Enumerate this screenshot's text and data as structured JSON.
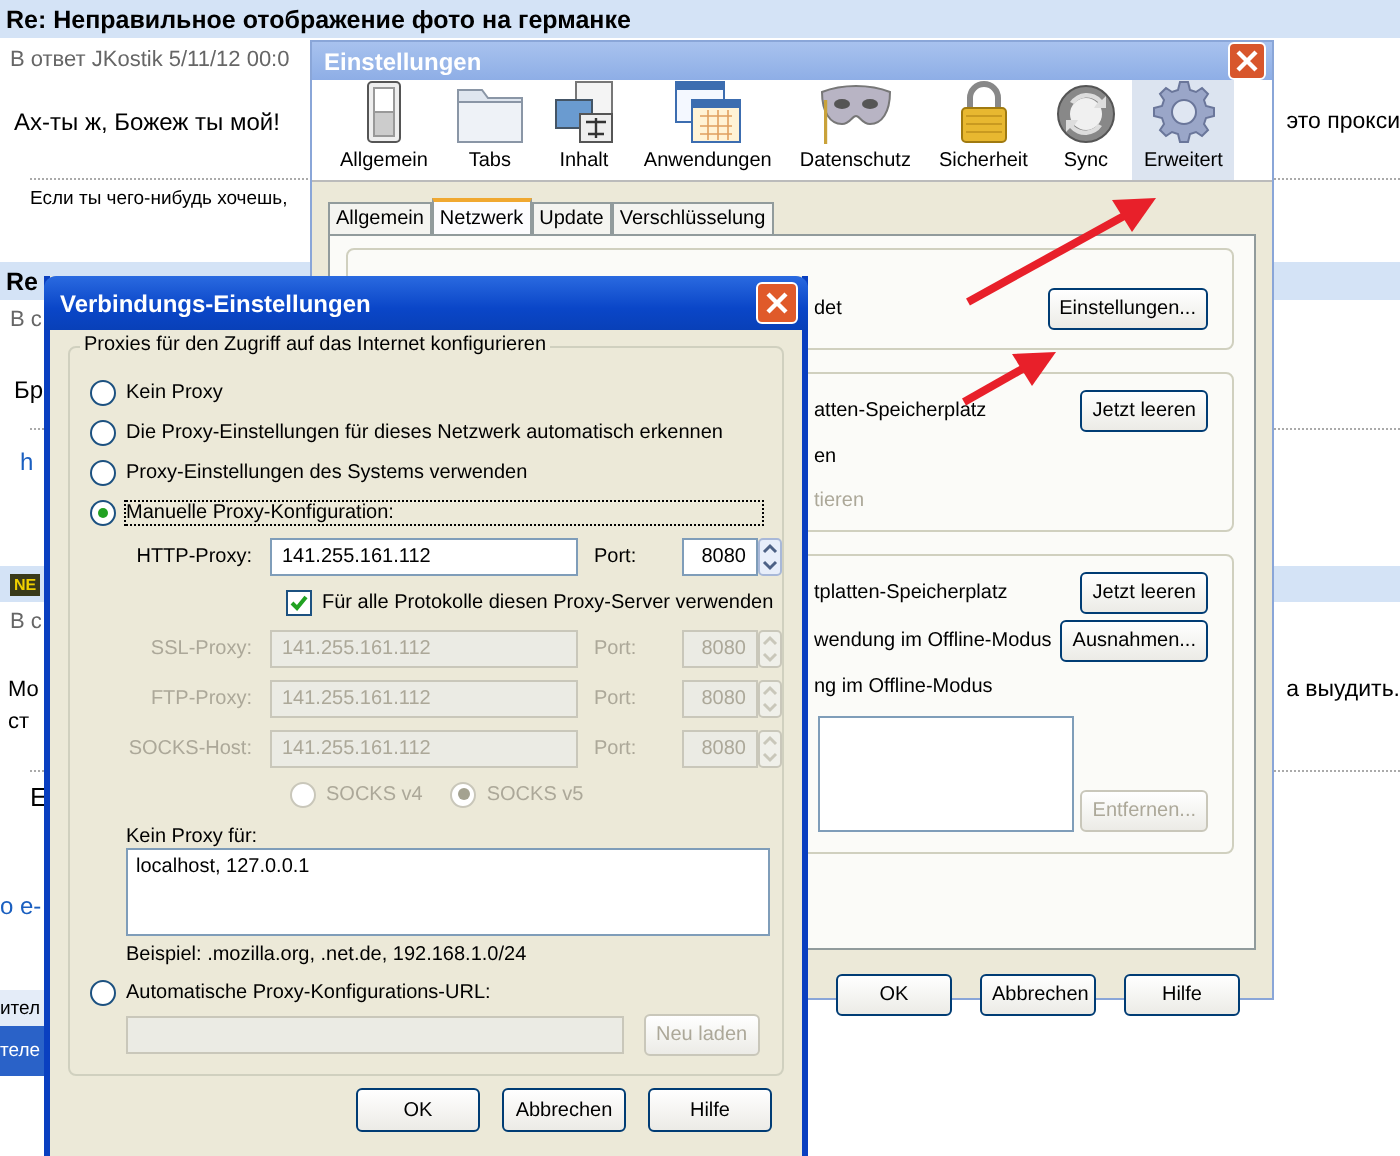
{
  "forum": {
    "thread_title": "Re: Неправильное отображение фото на германке",
    "reply_meta": "В ответ JKostik 5/11/12 00:0",
    "post_text": "Ах-ты ж, Божеж ты мой!",
    "post_text_right": "это прокси",
    "signature": "Если ты чего-нибудь хочешь,",
    "post2_header": "Re",
    "post2_meta": "В с",
    "post2_text": "Бр",
    "post2_link": "h",
    "post3_badge": "NE",
    "post3_meta": "В с",
    "post3_lines": [
      "Мо",
      "ст"
    ],
    "post3_text_right": "а выудить.",
    "post3_signature": "Е",
    "footer_link": "о е-",
    "bottom_bars": [
      "ител",
      "теле"
    ]
  },
  "prefs_window": {
    "title": "Einstellungen",
    "toolbar": [
      {
        "label": "Allgemein",
        "selected": false
      },
      {
        "label": "Tabs",
        "selected": false
      },
      {
        "label": "Inhalt",
        "selected": false
      },
      {
        "label": "Anwendungen",
        "selected": false
      },
      {
        "label": "Datenschutz",
        "selected": false
      },
      {
        "label": "Sicherheit",
        "selected": false
      },
      {
        "label": "Sync",
        "selected": false
      },
      {
        "label": "Erweitert",
        "selected": true
      }
    ],
    "tabs": [
      {
        "label": "Allgemein",
        "selected": false
      },
      {
        "label": "Netzwerk",
        "selected": true
      },
      {
        "label": "Update",
        "selected": false
      },
      {
        "label": "Verschlüsselung",
        "selected": false
      }
    ],
    "groups": [
      {
        "rows": [
          {
            "text": "det",
            "disabled": false,
            "button": {
              "label": "Einstellungen...",
              "disabled": false
            }
          }
        ]
      },
      {
        "rows": [
          {
            "text": "atten-Speicherplatz",
            "disabled": false,
            "button": {
              "label": "Jetzt leeren",
              "disabled": false
            }
          },
          {
            "text": "en",
            "disabled": false
          },
          {
            "text": "tieren",
            "disabled": true
          }
        ]
      },
      {
        "rows": [
          {
            "text": "tplatten-Speicherplatz",
            "disabled": false,
            "button": {
              "label": "Jetzt leeren",
              "disabled": false
            }
          },
          {
            "text": "wendung im Offline-Modus",
            "disabled": false,
            "button": {
              "label": "Ausnahmen...",
              "disabled": false
            }
          },
          {
            "text": "ng im Offline-Modus",
            "disabled": false
          }
        ],
        "list": {
          "button": {
            "label": "Entfernen...",
            "disabled": true
          }
        }
      }
    ],
    "buttons": [
      "OK",
      "Abbrechen",
      "Hilfe"
    ]
  },
  "connection_dialog": {
    "title": "Verbindungs-Einstellungen",
    "legend": "Proxies für den Zugriff auf das Internet konfigurieren",
    "modes": [
      {
        "label": "Kein Proxy",
        "selected": false
      },
      {
        "label": "Die Proxy-Einstellungen für dieses Netzwerk automatisch erkennen",
        "selected": false
      },
      {
        "label": "Proxy-Einstellungen des Systems verwenden",
        "selected": false
      },
      {
        "label": "Manuelle Proxy-Konfiguration:",
        "selected": true
      }
    ],
    "proxies": [
      {
        "label": "HTTP-Proxy:",
        "value": "141.255.161.112",
        "port_label": "Port:",
        "port": "8080",
        "disabled": false
      },
      {
        "label": "SSL-Proxy:",
        "value": "141.255.161.112",
        "port_label": "Port:",
        "port": "8080",
        "disabled": true
      },
      {
        "label": "FTP-Proxy:",
        "value": "141.255.161.112",
        "port_label": "Port:",
        "port": "8080",
        "disabled": true
      },
      {
        "label": "SOCKS-Host:",
        "value": "141.255.161.112",
        "port_label": "Port:",
        "port": "8080",
        "disabled": true
      }
    ],
    "share_all": {
      "label": "Für alle Protokolle diesen Proxy-Server verwenden",
      "checked": true
    },
    "socks_versions": [
      {
        "label": "SOCKS v4",
        "selected": false,
        "disabled": true
      },
      {
        "label": "SOCKS v5",
        "selected": true,
        "disabled": true
      }
    ],
    "no_proxy": {
      "label": "Kein Proxy für:",
      "value": "localhost, 127.0.0.1",
      "example": "Beispiel: .mozilla.org, .net.de, 192.168.1.0/24"
    },
    "auto": {
      "label": "Automatische Proxy-Konfigurations-URL:",
      "selected": false,
      "reload_button": "Neu laden",
      "disabled": true
    },
    "buttons": [
      "OK",
      "Abbrechen",
      "Hilfe"
    ]
  }
}
